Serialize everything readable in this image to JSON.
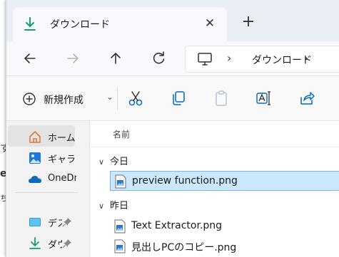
{
  "window": {
    "tab_title": "ダウンロード",
    "close_glyph": "✕",
    "new_tab_glyph": "+"
  },
  "address": {
    "separator": "›",
    "crumb": "ダウンロード"
  },
  "toolbar": {
    "new_label": "新規作成",
    "new_chevron": "⌄"
  },
  "sidebar": {
    "items": [
      {
        "label": "ホーム",
        "icon": "home-icon"
      },
      {
        "label": "ギャラリー",
        "icon": "gallery-icon"
      },
      {
        "label": "OneDrive",
        "icon": "onedrive-icon"
      },
      {
        "label": "デスクトップ",
        "icon": "desktop-icon"
      },
      {
        "label": "ダウンロード",
        "icon": "download-icon"
      }
    ]
  },
  "content": {
    "column_name": "名前",
    "groups": [
      {
        "label": "今日",
        "files": [
          "preview function.png"
        ]
      },
      {
        "label": "昨日",
        "files": [
          "Text Extractor.png",
          "見出しPCのコピー.png"
        ]
      }
    ]
  },
  "colors": {
    "accent": "#0067c0",
    "selected_row": "#cce8ff",
    "tab_bar": "#e9eef5"
  }
}
